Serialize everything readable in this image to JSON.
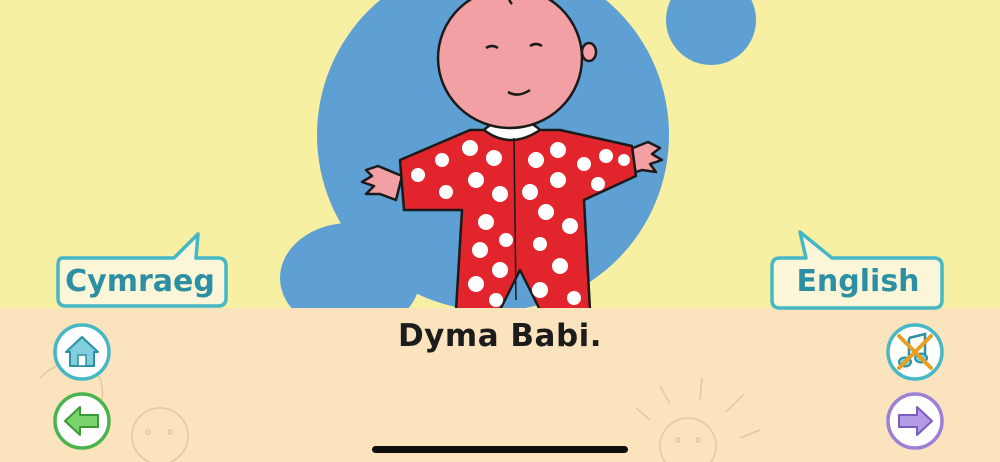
{
  "caption": "Dyma Babi.",
  "language_buttons": {
    "welsh_label": "Cymraeg",
    "english_label": "English"
  },
  "controls": {
    "home": "home-icon",
    "back": "arrow-left-icon",
    "sound_toggle": "sound-off-icon",
    "forward": "arrow-right-icon"
  },
  "colors": {
    "background_yellow": "#f7efa2",
    "panel_peach": "#fae3bd",
    "blob_blue": "#5ea0d3",
    "accent_teal": "#2c8fa3",
    "green": "#4bb34b",
    "purple": "#9c7fd6",
    "pajama_red": "#e2242c"
  }
}
